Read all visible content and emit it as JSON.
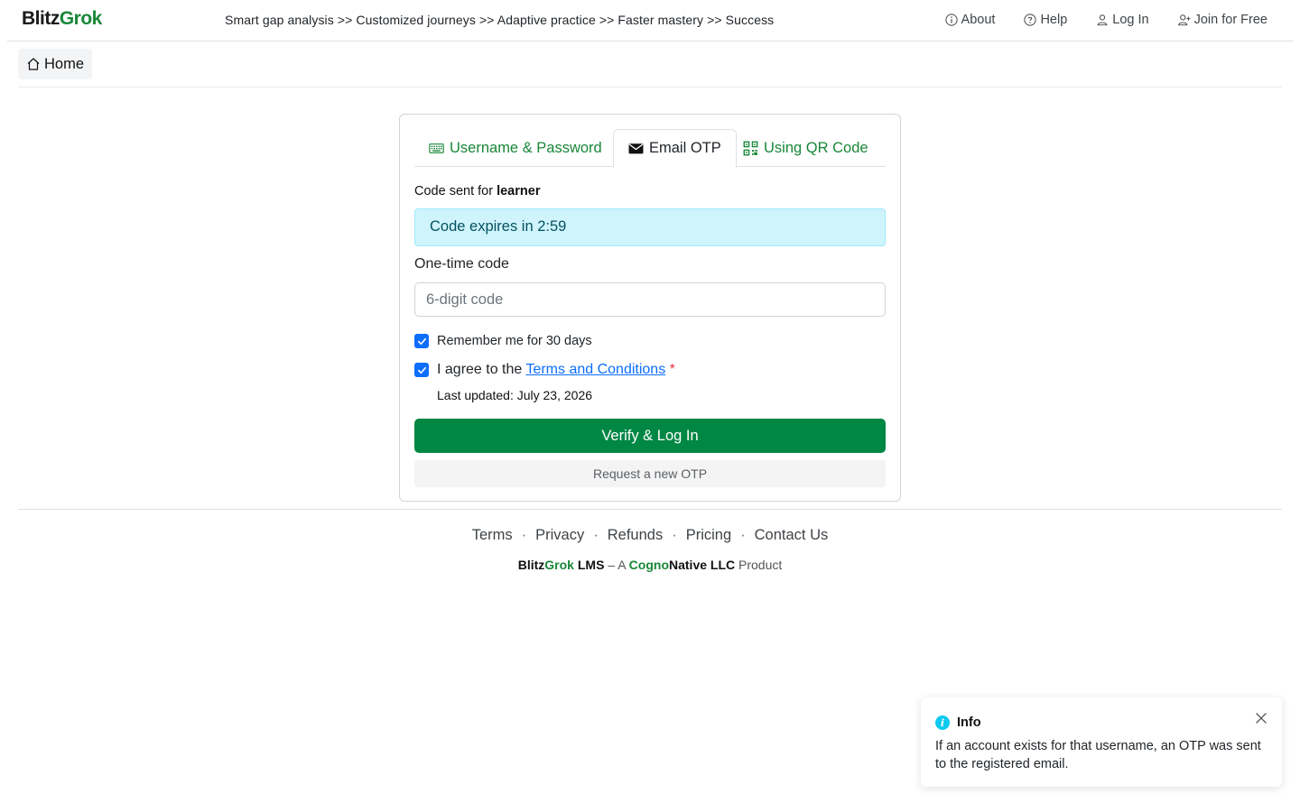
{
  "brand": {
    "part1": "Blitz",
    "part2": "Grok"
  },
  "tagline": "Smart gap analysis >> Customized journeys >> Adaptive practice >> Faster mastery >> Success",
  "nav": {
    "about": "About",
    "help": "Help",
    "login": "Log In",
    "join": "Join for Free"
  },
  "breadcrumb": {
    "home": "Home"
  },
  "tabs": {
    "username_password": "Username & Password",
    "email_otp": "Email OTP",
    "qr_code": "Using QR Code",
    "active": "email_otp"
  },
  "form": {
    "code_sent_prefix": "Code sent for",
    "username": "learner",
    "expires": "Code expires in 2:59",
    "otp_label": "One-time code",
    "otp_placeholder": "6-digit code",
    "otp_value": "",
    "remember_label": "Remember me for 30 days",
    "remember_checked": true,
    "agree_prefix": "I agree to the",
    "terms_link": "Terms and Conditions",
    "required_mark": "*",
    "agree_checked": true,
    "last_updated": "Last updated: July 23, 2026",
    "verify_button": "Verify & Log In",
    "resend_button": "Request a new OTP"
  },
  "footer": {
    "links": [
      "Terms",
      "Privacy",
      "Refunds",
      "Pricing",
      "Contact Us"
    ],
    "separator": "·",
    "credit": {
      "brand1": "Blitz",
      "brand2": "Grok",
      "lms": "LMS",
      "dash_a": "– A",
      "co1": "Cogno",
      "co2": "Native LLC",
      "product": "Product"
    }
  },
  "toast": {
    "title": "Info",
    "message": "If an account exists for that username, an OTP was sent to the registered email."
  },
  "colors": {
    "brand_green": "#198738",
    "button_green": "#008744",
    "link_blue": "#0d6efd",
    "alert_bg": "#cff4fc",
    "info_icon": "#0dcaf0"
  }
}
